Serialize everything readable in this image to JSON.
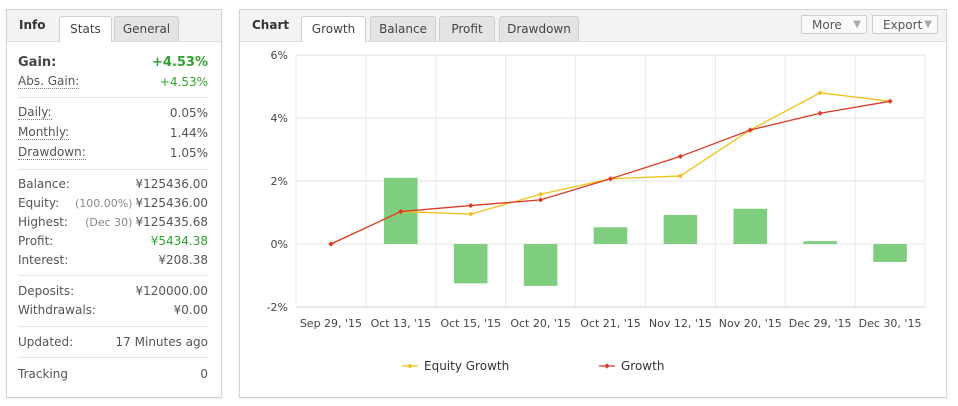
{
  "info_panel": {
    "title": "Info",
    "tabs": [
      {
        "label": "Stats"
      },
      {
        "label": "General"
      }
    ],
    "gain": {
      "label": "Gain:",
      "value": "+4.53%"
    },
    "abs_gain": {
      "label": "Abs. Gain:",
      "value": "+4.53%"
    },
    "daily": {
      "label": "Daily:",
      "value": "0.05%"
    },
    "monthly": {
      "label": "Monthly:",
      "value": "1.44%"
    },
    "drawdown": {
      "label": "Drawdown:",
      "value": "1.05%"
    },
    "balance": {
      "label": "Balance:",
      "value": "¥125436.00"
    },
    "equity": {
      "label": "Equity:",
      "prefix": "(100.00%)",
      "value": "¥125436.00"
    },
    "highest": {
      "label": "Highest:",
      "prefix": "(Dec 30)",
      "value": "¥125435.68"
    },
    "profit": {
      "label": "Profit:",
      "value": "¥5434.38"
    },
    "interest": {
      "label": "Interest:",
      "value": "¥208.38"
    },
    "deposits": {
      "label": "Deposits:",
      "value": "¥120000.00"
    },
    "withdrawals": {
      "label": "Withdrawals:",
      "value": "¥0.00"
    },
    "updated": {
      "label": "Updated:",
      "value": "17 Minutes ago"
    },
    "tracking": {
      "label": "Tracking",
      "value": "0"
    }
  },
  "chart_panel": {
    "title": "Chart",
    "tabs": [
      {
        "label": "Growth"
      },
      {
        "label": "Balance"
      },
      {
        "label": "Profit"
      },
      {
        "label": "Drawdown"
      }
    ],
    "more_label": "More",
    "export_label": "Export"
  },
  "colors": {
    "gain_green": "#2ea330",
    "bar_green": "#7fcd7f",
    "equity_line": "#f2c21a",
    "growth_line": "#dd3b2a"
  },
  "chart_data": {
    "type": "bar",
    "categories": [
      "Sep 29, '15",
      "Oct 13, '15",
      "Oct 15, '15",
      "Oct 20, '15",
      "Oct 21, '15",
      "Nov 12, '15",
      "Nov 20, '15",
      "Dec 29, '15",
      "Dec 30, '15"
    ],
    "ylim": [
      -2,
      6
    ],
    "yticks": [
      "6%",
      "4%",
      "2%",
      "0%",
      "-2%"
    ],
    "ytick_values": [
      6,
      4,
      2,
      0,
      -2
    ],
    "bars": {
      "values": [
        0,
        2.1,
        -1.25,
        -1.33,
        0.53,
        0.92,
        1.12,
        0.09,
        -0.57
      ]
    },
    "series": [
      {
        "name": "Equity Growth",
        "values": [
          0,
          1.03,
          0.95,
          1.58,
          2.07,
          2.16,
          3.62,
          4.8,
          4.53
        ]
      },
      {
        "name": "Growth",
        "values": [
          0,
          1.03,
          1.22,
          1.4,
          2.07,
          2.78,
          3.62,
          4.15,
          4.53
        ]
      }
    ],
    "legend_position": "bottom",
    "grid": true
  }
}
